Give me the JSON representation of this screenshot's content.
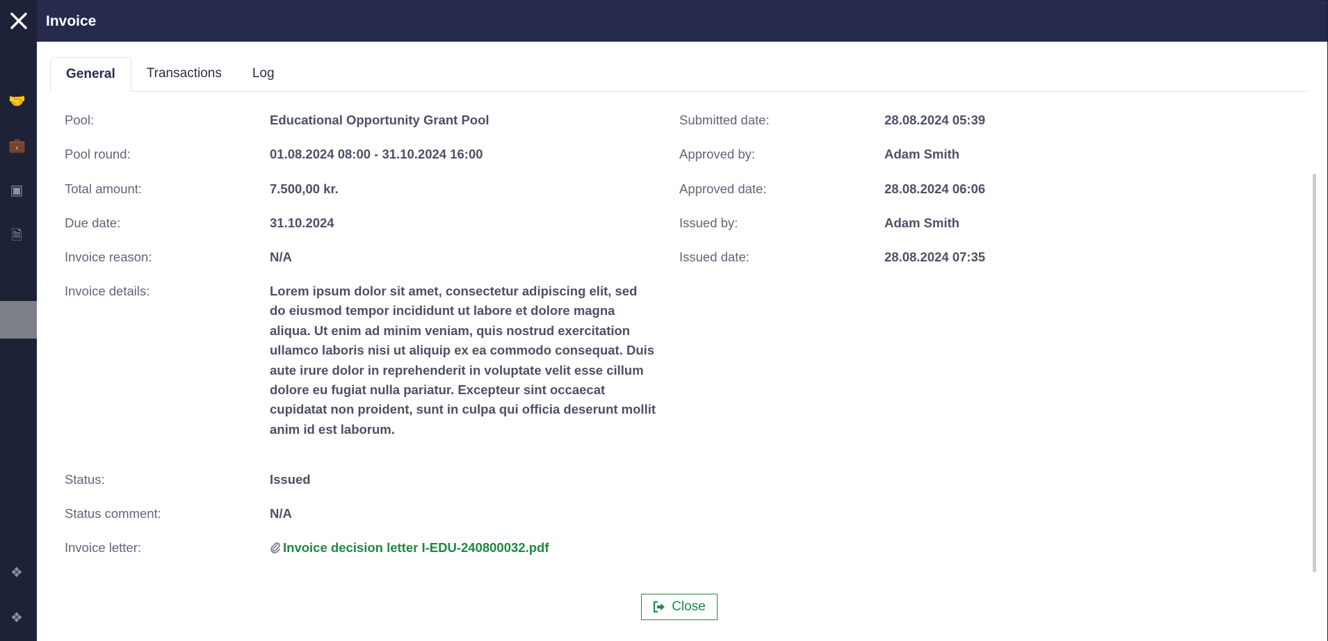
{
  "modal": {
    "title": "Invoice",
    "tabs": [
      {
        "label": "General",
        "active": true
      },
      {
        "label": "Transactions",
        "active": false
      },
      {
        "label": "Log",
        "active": false
      }
    ]
  },
  "general": {
    "left": [
      {
        "label": "Pool:",
        "value": "Educational Opportunity Grant Pool"
      },
      {
        "label": "Pool round:",
        "value": "01.08.2024 08:00 - 31.10.2024 16:00"
      },
      {
        "label": "Total amount:",
        "value": "7.500,00 kr."
      },
      {
        "label": "Due date:",
        "value": "31.10.2024"
      },
      {
        "label": "Invoice reason:",
        "value": "N/A"
      },
      {
        "label": "Invoice details:",
        "value": "Lorem ipsum dolor sit amet, consectetur adipiscing elit, sed do eiusmod tempor incididunt ut labore et dolore magna aliqua. Ut enim ad minim veniam, quis nostrud exercitation ullamco laboris nisi ut aliquip ex ea commodo consequat. Duis aute irure dolor in reprehenderit in voluptate velit esse cillum dolore eu fugiat nulla pariatur. Excepteur sint occaecat cupidatat non proident, sunt in culpa qui officia deserunt mollit anim id est laborum."
      },
      {
        "label": "Status:",
        "value": "Issued"
      },
      {
        "label": "Status comment:",
        "value": "N/A"
      },
      {
        "label": "Invoice letter:",
        "value": "Invoice decision letter I-EDU-240800032.pdf"
      }
    ],
    "right": [
      {
        "label": "Submitted date:",
        "value": "28.08.2024 05:39"
      },
      {
        "label": "Approved by:",
        "value": "Adam Smith"
      },
      {
        "label": "Approved date:",
        "value": "28.08.2024 06:06"
      },
      {
        "label": "Issued by:",
        "value": "Adam Smith"
      },
      {
        "label": "Issued date:",
        "value": "28.08.2024 07:35"
      }
    ]
  },
  "footer": {
    "close_label": "Close"
  },
  "icons": {
    "modal_close": "close-icon",
    "attachment": "paperclip-icon",
    "close_button": "sign-out-icon"
  },
  "colors": {
    "header_bg": "#262b4e",
    "nav_bg": "#1e2236",
    "link_green": "#1a8a3e",
    "label": "#5f6478",
    "value": "#4b5066"
  }
}
